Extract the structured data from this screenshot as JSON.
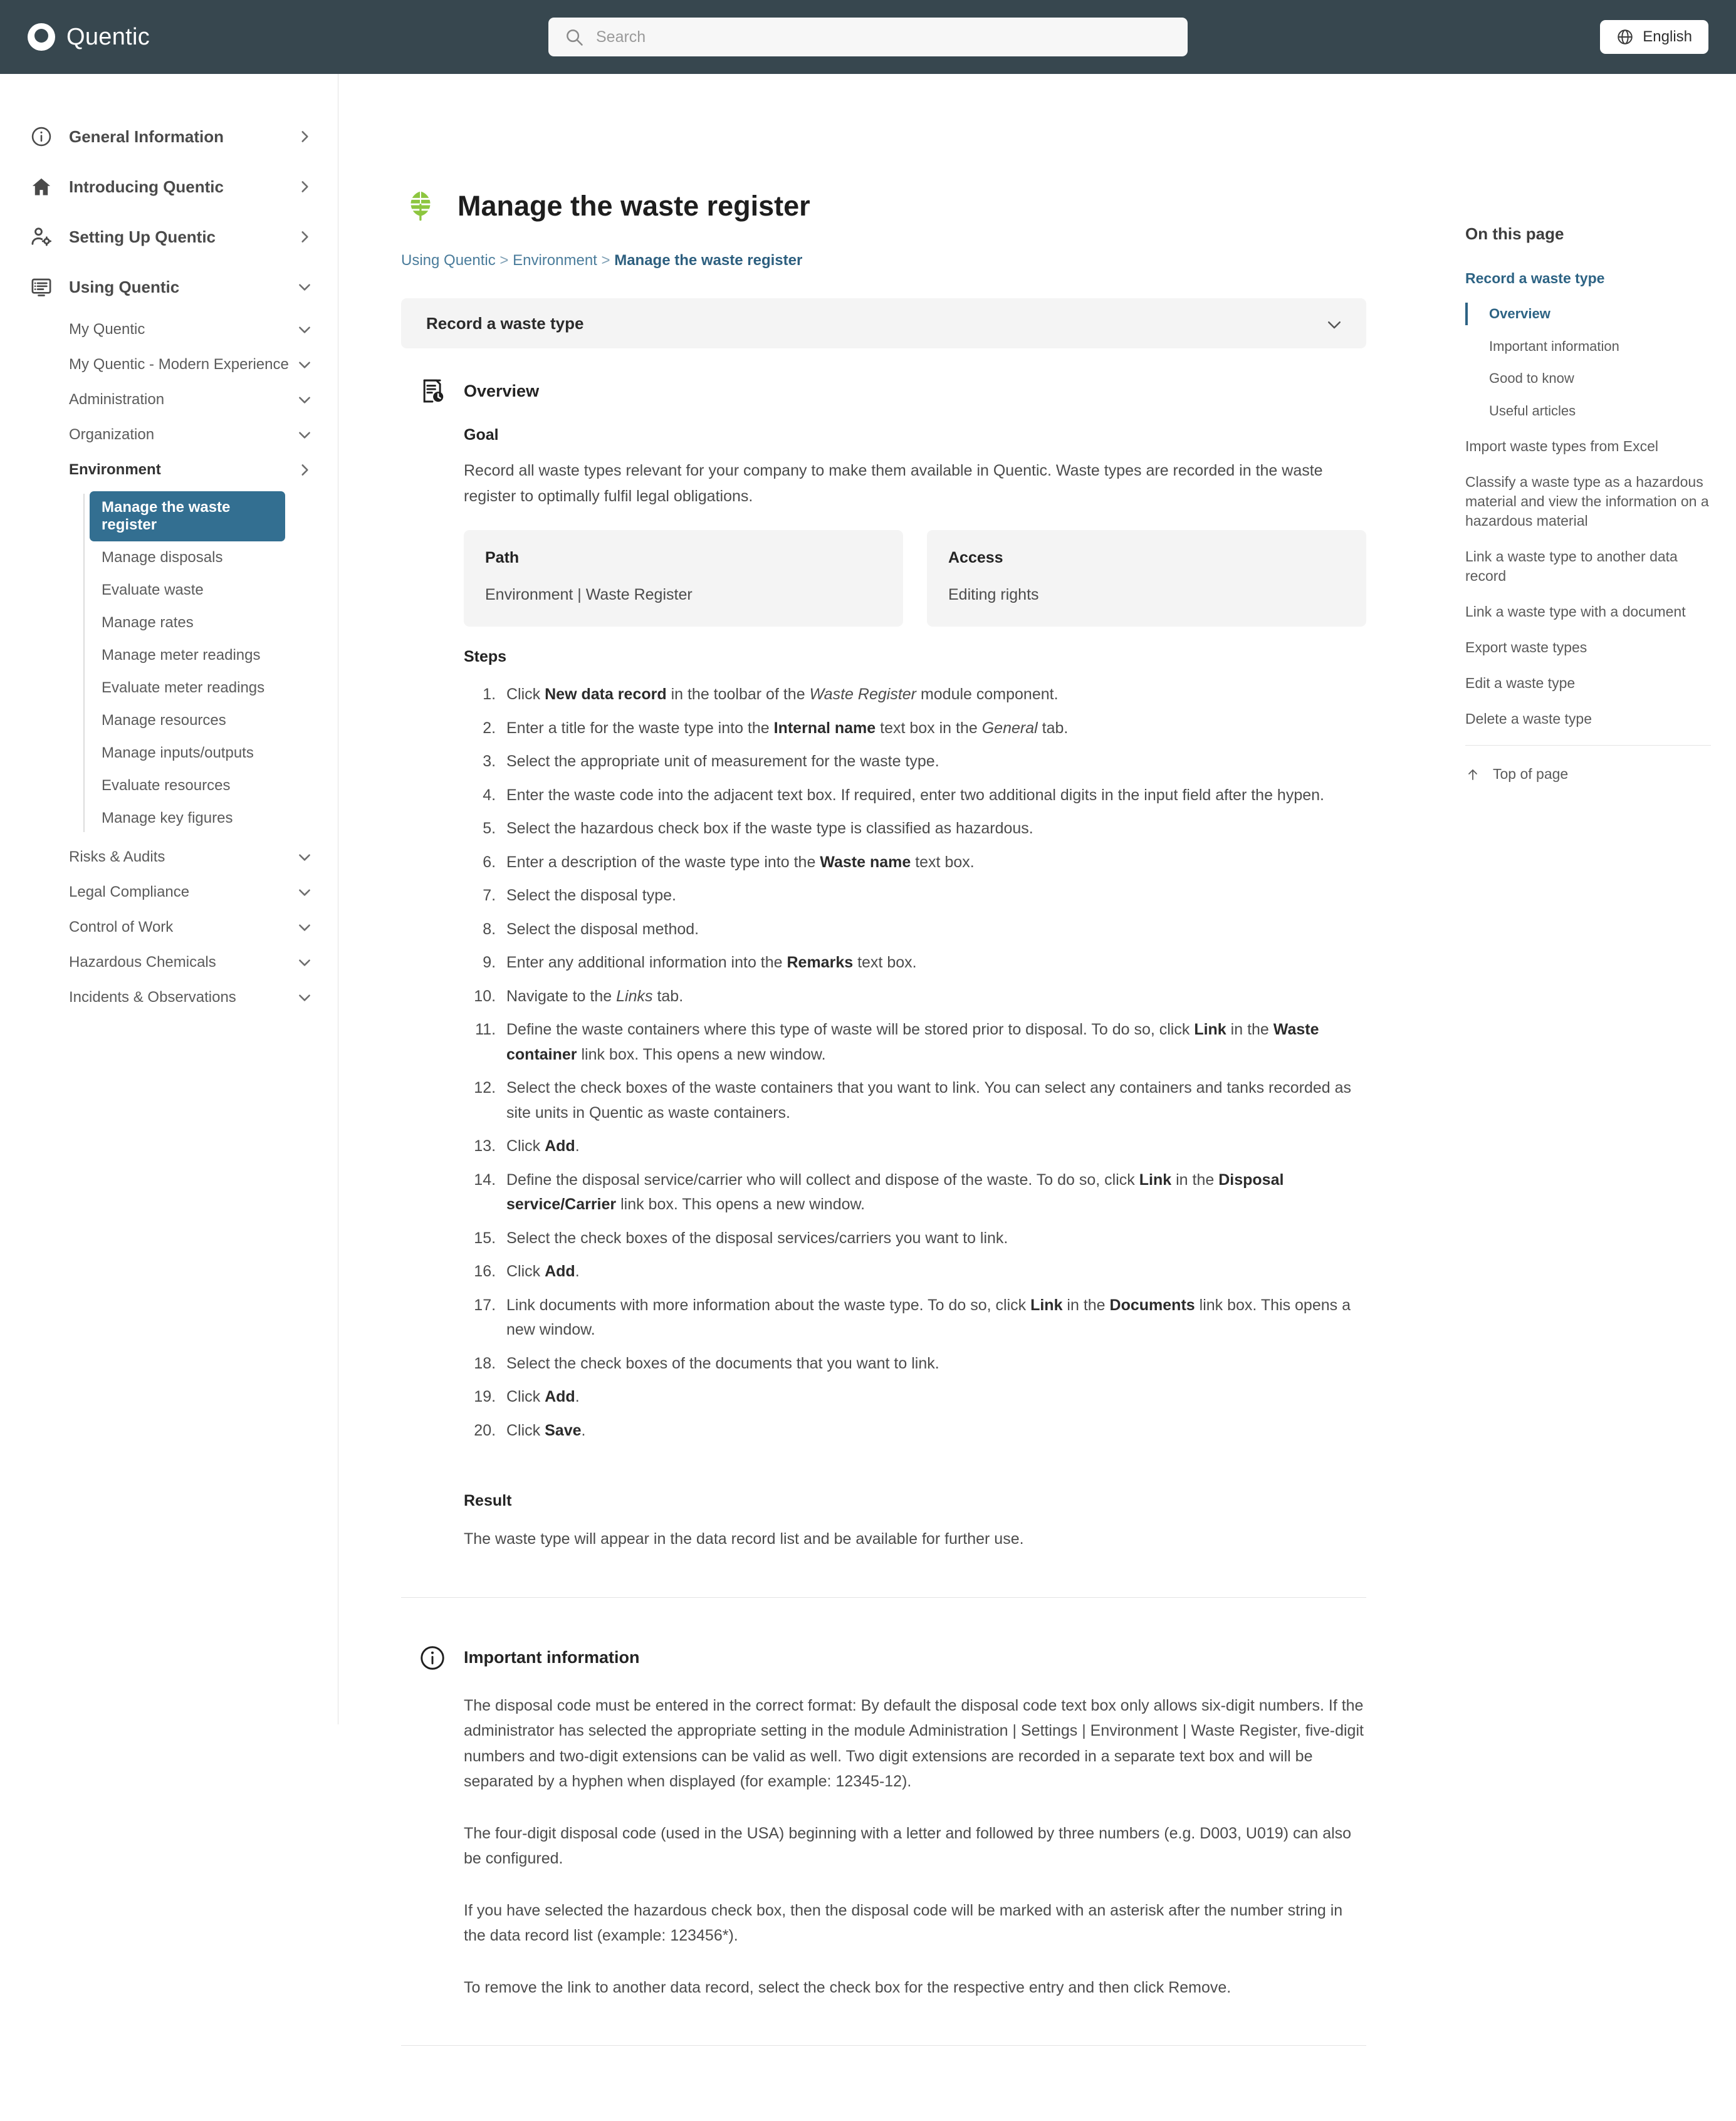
{
  "header": {
    "brand": "Quentic",
    "search_placeholder": "Search",
    "search_value": "",
    "language": "English",
    "icons": {
      "search": "search-icon",
      "globe": "globe-icon"
    }
  },
  "sidebar": {
    "top_items": [
      {
        "label": "General Information",
        "icon": "info-circle-icon",
        "chevron": "chevron-right"
      },
      {
        "label": "Introducing Quentic",
        "icon": "home-icon",
        "chevron": "chevron-right"
      },
      {
        "label": "Setting Up Quentic",
        "icon": "user-gear-icon",
        "chevron": "chevron-right"
      },
      {
        "label": "Using Quentic",
        "icon": "list-screen-icon",
        "chevron": "chevron-down"
      }
    ],
    "sub_items": [
      {
        "label": "My Quentic",
        "chevron": "chevron-down",
        "bold": false
      },
      {
        "label": "My Quentic - Modern Experience",
        "chevron": "chevron-down",
        "bold": false
      },
      {
        "label": "Administration",
        "chevron": "chevron-down",
        "bold": false
      },
      {
        "label": "Organization",
        "chevron": "chevron-down",
        "bold": false
      },
      {
        "label": "Environment",
        "chevron": "chevron-right",
        "bold": true
      }
    ],
    "environment_children": [
      {
        "label": "Manage the waste register",
        "active": true
      },
      {
        "label": "Manage disposals",
        "active": false
      },
      {
        "label": "Evaluate waste",
        "active": false
      },
      {
        "label": "Manage rates",
        "active": false
      },
      {
        "label": "Manage meter readings",
        "active": false
      },
      {
        "label": "Evaluate meter readings",
        "active": false
      },
      {
        "label": "Manage resources",
        "active": false
      },
      {
        "label": "Manage inputs/outputs",
        "active": false
      },
      {
        "label": "Evaluate resources",
        "active": false
      },
      {
        "label": "Manage key figures",
        "active": false
      }
    ],
    "tail_items": [
      {
        "label": "Risks & Audits",
        "chevron": "chevron-down"
      },
      {
        "label": "Legal Compliance",
        "chevron": "chevron-down"
      },
      {
        "label": "Control of Work",
        "chevron": "chevron-down"
      },
      {
        "label": "Hazardous Chemicals",
        "chevron": "chevron-down"
      },
      {
        "label": "Incidents & Observations",
        "chevron": "chevron-down"
      }
    ],
    "active_color": "#336f91"
  },
  "page": {
    "title": "Manage the waste register",
    "title_icon": "leaf-icon",
    "title_icon_color": "#8DC63F",
    "breadcrumb": {
      "item1": "Using Quentic",
      "item2": "Environment",
      "current": "Manage the waste register",
      "separator": ">"
    },
    "accordion_title": "Record a waste type"
  },
  "overview": {
    "icon": "document-clock-icon",
    "heading": "Overview",
    "goal_label": "Goal",
    "goal_text": "Record all waste types relevant for your company to make them available in Quentic. Waste types are recorded in the waste register to optimally fulfil legal obligations.",
    "path_label": "Path",
    "path_value": "Environment | Waste Register",
    "access_label": "Access",
    "access_value": "Editing rights",
    "steps_label": "Steps",
    "steps": [
      "Click <b>New data record</b> in the toolbar of the <i>Waste Register</i> module component.",
      "Enter a title for the waste type into the <b>Internal name</b> text box in the <i>General</i> tab.",
      "Select the appropriate unit of measurement for the waste type.",
      "Enter the waste code into the adjacent text box. If required, enter two additional digits in the input field after the hypen.",
      "Select the hazardous check box if the waste type is classified as hazardous.",
      "Enter a description of the waste type into the <b>Waste name</b> text box.",
      "Select the disposal type.",
      "Select the disposal method.",
      "Enter any additional information into the <b>Remarks</b> text box.",
      "Navigate to the <i>Links</i> tab.",
      "Define the waste containers where this type of waste will be stored prior to disposal. To do so, click <b>Link</b> in the <b>Waste container</b> link box. This opens a new window.",
      "Select the check boxes of the waste containers that you want to link. You can select any containers and tanks recorded as site units in Quentic as waste containers.",
      "Click <b>Add</b>.",
      "Define the disposal service/carrier who will collect and dispose of the waste. To do so, click <b>Link</b> in the <b>Disposal service/Carrier</b> link box. This opens a new window.",
      "Select the check boxes of the disposal services/carriers you want to link.",
      "Click <b>Add</b>.",
      "Link documents with more information about the waste type. To do so, click <b>Link</b> in the <b>Documents</b> link box. This opens a new window.",
      "Select the check boxes of the documents that you want to link.",
      "Click <b>Add</b>.",
      "Click <b>Save</b>."
    ],
    "result_label": "Result",
    "result_text": "The waste type will appear in the data record list and be available for further use."
  },
  "important_information": {
    "icon": "info-circle-icon",
    "heading": "Important information",
    "paragraphs": [
      "The disposal code must be entered in the correct format: By default the disposal code text box only allows six-digit numbers. If the administrator has selected the appropriate setting in the module Administration | Settings | Environment | Waste Register, five-digit numbers and two-digit extensions can be valid as well. Two digit extensions are recorded in a separate text box and will be separated by a hyphen when displayed (for example: 12345-12).",
      "The four-digit disposal code (used in the USA) beginning with a letter and followed by three numbers (e.g. D003, U019) can also be configured.",
      "If you have selected the hazardous check box, then the disposal code will be marked with an asterisk after the number string in the data record list (example: 123456*).",
      "To remove the link to another data record, select the check box for the respective entry and then click Remove."
    ]
  },
  "toc": {
    "heading": "On this page",
    "section_title": "Record a waste type",
    "sub_items": [
      {
        "label": "Overview",
        "current": true
      },
      {
        "label": "Important information",
        "current": false
      },
      {
        "label": "Good to know",
        "current": false
      },
      {
        "label": "Useful articles",
        "current": false
      }
    ],
    "items": [
      "Import waste types from Excel",
      "Classify a waste type as a hazardous material and view the information on a hazardous material",
      "Link a waste type to another data record",
      "Link a waste type with a document",
      "Export waste types",
      "Edit a waste type",
      "Delete a waste type"
    ],
    "top_of_page": "Top of page",
    "top_icon": "arrow-up-icon"
  }
}
